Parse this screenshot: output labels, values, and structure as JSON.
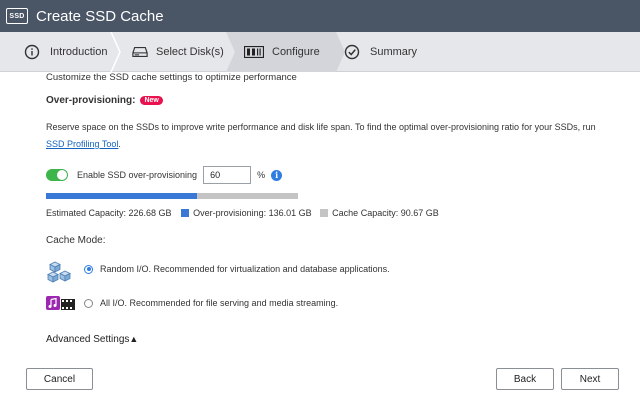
{
  "window": {
    "logo_text": "SSD",
    "title": "Create SSD Cache"
  },
  "steps": [
    {
      "label": "Introduction",
      "icon": "info-icon",
      "active": false
    },
    {
      "label": "Select Disk(s)",
      "icon": "disk-icon",
      "active": false
    },
    {
      "label": "Configure",
      "icon": "configure-icon",
      "active": true
    },
    {
      "label": "Summary",
      "icon": "check-circle-icon",
      "active": false
    }
  ],
  "configure": {
    "subtitle": "Customize the SSD cache settings to optimize performance",
    "overprov": {
      "title": "Over-provisioning:",
      "badge": "New",
      "description": "Reserve space on the SSDs to improve write performance and disk life span. To find the optimal over-provisioning ratio for your SSDs, run",
      "link": "SSD Profiling Tool",
      "link_suffix": ".",
      "toggle_label": "Enable SSD over-provisioning",
      "toggle_on": true,
      "value": "60",
      "unit": "%"
    },
    "capacity": {
      "estimated_label": "Estimated Capacity: 226.68 GB",
      "overprov_label": "Over-provisioning: 136.01 GB",
      "cache_label": "Cache Capacity: 90.67 GB",
      "overprov_fraction": 0.6,
      "overprov_color": "#3a78d6",
      "cache_color": "#c4c4c4"
    },
    "cache_mode": {
      "title": "Cache Mode:",
      "options": [
        {
          "label": "Random I/O. Recommended for virtualization and database applications.",
          "icon": "cubes-icon",
          "selected": true
        },
        {
          "label": "All I/O. Recommended for file serving and media streaming.",
          "icon": "media-icon",
          "selected": false
        }
      ]
    },
    "advanced": {
      "label": "Advanced Settings",
      "arrow": "▲"
    }
  },
  "footer": {
    "cancel": "Cancel",
    "back": "Back",
    "next": "Next"
  },
  "colors": {
    "titlebar": "#4a5566",
    "accent": "#2e7de1",
    "badge": "#e8124f",
    "toggle_on": "#3db54a"
  }
}
